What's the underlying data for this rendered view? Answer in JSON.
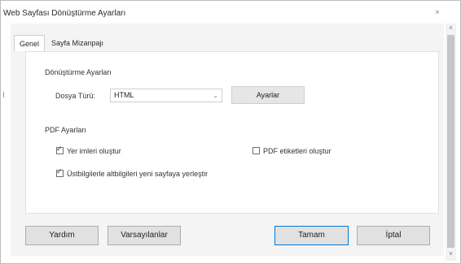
{
  "dialog": {
    "title": "Web Sayfası Dönüştürme Ayarları",
    "close_glyph": "×"
  },
  "tabs": [
    {
      "label": "Genel",
      "selected": true
    },
    {
      "label": "Sayfa Mizanpajı",
      "selected": false
    }
  ],
  "conversion": {
    "section_title": "Dönüştürme Ayarları",
    "file_type_label": "Dosya Türü:",
    "file_type_value": "HTML",
    "select_arrow": "⌄",
    "settings_button": "Ayarlar"
  },
  "pdf": {
    "section_title": "PDF Ayarları",
    "create_bookmarks": {
      "label": "Yer imleri oluştur",
      "checked": true
    },
    "create_pdf_tags": {
      "label": "PDF etiketleri oluştur",
      "checked": false
    },
    "place_headers_footers": {
      "label": "Üstbilgilerle altbilgileri yeni sayfaya yerleştir",
      "checked": true
    }
  },
  "buttons": {
    "help": "Yardım",
    "defaults": "Varsayılanlar",
    "ok": "Tamam",
    "cancel": "İptal"
  },
  "scrollbar": {
    "up_glyph": "˄",
    "down_glyph": "˅"
  },
  "icons": {
    "close": "close-icon",
    "checkmark": "checkmark-icon",
    "dropdown": "chevron-down-icon",
    "scroll_up": "chevron-up-icon",
    "scroll_down": "chevron-down-icon"
  },
  "colors": {
    "panel_background": "#f4f4f4",
    "ok_button_border": "#0078d7",
    "button_background": "#e1e1e1"
  }
}
